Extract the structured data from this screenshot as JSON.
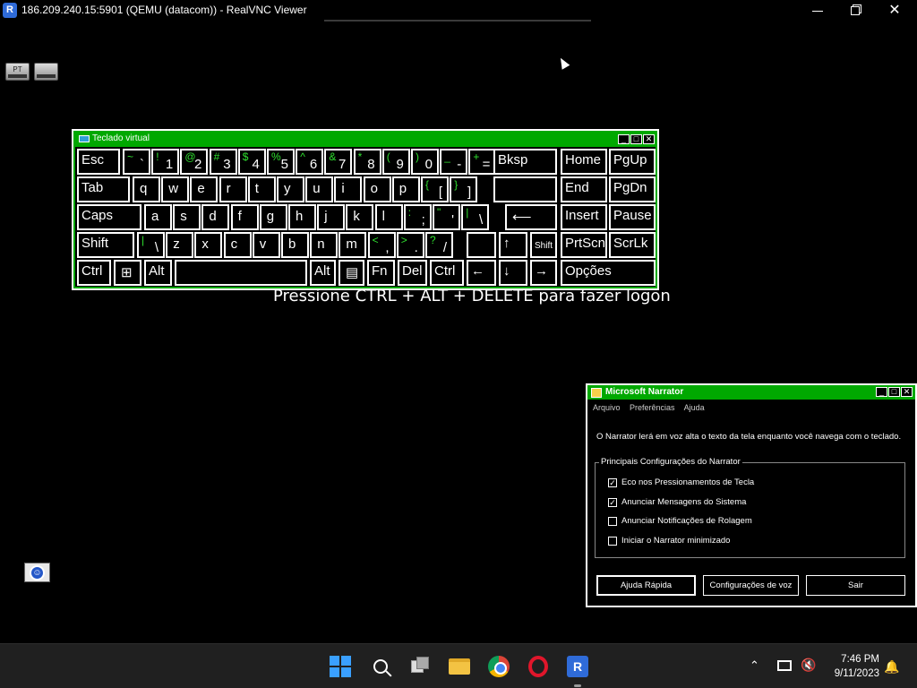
{
  "vnc": {
    "title": "186.209.240.15:5901 (QEMU (datacom)) - RealVNC Viewer",
    "logo_letter": "R",
    "minimize_icon": "minimize-icon",
    "maximize_icon": "restore-icon",
    "close_icon": "close-icon",
    "close_glyph": "✕"
  },
  "desktop": {
    "lang_indicator": "PT",
    "logon_message": "Pressione CTRL + ALT + DELETE para fazer logon"
  },
  "osk": {
    "title": "Teclado virtual",
    "title_buttons": [
      "_",
      "□",
      "✕"
    ],
    "accent": "#00a800",
    "shift_symbol_color": "#2fe02f",
    "keys": {
      "esc": "Esc",
      "tab": "Tab",
      "caps": "Caps",
      "shift": "Shift",
      "ctrl": "Ctrl",
      "alt": "Alt",
      "bksp": "Bksp",
      "home": "Home",
      "pgup": "PgUp",
      "end": "End",
      "pgdn": "PgDn",
      "insert": "Insert",
      "pause": "Pause",
      "prtscn": "PrtScn",
      "scrlk": "ScrLk",
      "altgr": "Alt",
      "fn": "Fn",
      "del": "Del",
      "ctrl_r": "Ctrl",
      "shift_r": "Shift",
      "opcoes": "Opções",
      "enter_glyph": "⟵",
      "win_glyph": "⊞",
      "menu_glyph": "▤",
      "left": "←",
      "down": "↓",
      "right": "→",
      "up": "↑"
    },
    "row1": [
      {
        "up": "~",
        "dn": "`"
      },
      {
        "up": "!",
        "dn": "1"
      },
      {
        "up": "@",
        "dn": "2"
      },
      {
        "up": "#",
        "dn": "3"
      },
      {
        "up": "$",
        "dn": "4"
      },
      {
        "up": "%",
        "dn": "5"
      },
      {
        "up": "^",
        "dn": "6"
      },
      {
        "up": "&",
        "dn": "7"
      },
      {
        "up": "*",
        "dn": "8"
      },
      {
        "up": "(",
        "dn": "9"
      },
      {
        "up": ")",
        "dn": "0"
      },
      {
        "up": "_",
        "dn": "-"
      },
      {
        "up": "+",
        "dn": "="
      }
    ],
    "row2": [
      "q",
      "w",
      "e",
      "r",
      "t",
      "y",
      "u",
      "i",
      "o",
      "p"
    ],
    "row2_sym": [
      {
        "up": "{",
        "dn": "["
      },
      {
        "up": "}",
        "dn": "]"
      }
    ],
    "row3": [
      "a",
      "s",
      "d",
      "f",
      "g",
      "h",
      "j",
      "k",
      "l"
    ],
    "row3_sym": [
      {
        "up": ":",
        "dn": ";"
      },
      {
        "up": "\"",
        "dn": "'"
      },
      {
        "up": "|",
        "dn": "\\"
      }
    ],
    "row4_sym0": {
      "up": "|",
      "dn": "\\"
    },
    "row4": [
      "z",
      "x",
      "c",
      "v",
      "b",
      "n",
      "m"
    ],
    "row4_sym": [
      {
        "up": "<",
        "dn": ","
      },
      {
        "up": ">",
        "dn": "."
      },
      {
        "up": "?",
        "dn": "/"
      }
    ]
  },
  "narrator": {
    "title": "Microsoft Narrator",
    "menu": [
      "Arquivo",
      "Preferências",
      "Ajuda"
    ],
    "description": "O Narrator lerá em voz alta o texto da tela enquanto você navega com o teclado.",
    "group_label": "Principais Configurações do Narrator",
    "options": [
      {
        "label": "Eco nos Pressionamentos de Tecla",
        "checked": true
      },
      {
        "label": "Anunciar Mensagens do Sistema",
        "checked": true
      },
      {
        "label": "Anunciar Notificações de Rolagem",
        "checked": false
      },
      {
        "label": "Iniciar o Narrator minimizado",
        "checked": false
      }
    ],
    "buttons": [
      "Ajuda Rápida",
      "Configurações de voz",
      "Sair"
    ],
    "check_glyph": "✓"
  },
  "taskbar": {
    "time": "7:46 PM",
    "date": "9/11/2023",
    "chevron": "⌃",
    "volume_glyph": "🔇",
    "bell_glyph": "🔔",
    "vnc_letter": "R",
    "icons": [
      "start-icon",
      "search-icon",
      "task-view-icon",
      "file-explorer-icon",
      "chrome-icon",
      "opera-icon",
      "realvnc-icon"
    ]
  }
}
